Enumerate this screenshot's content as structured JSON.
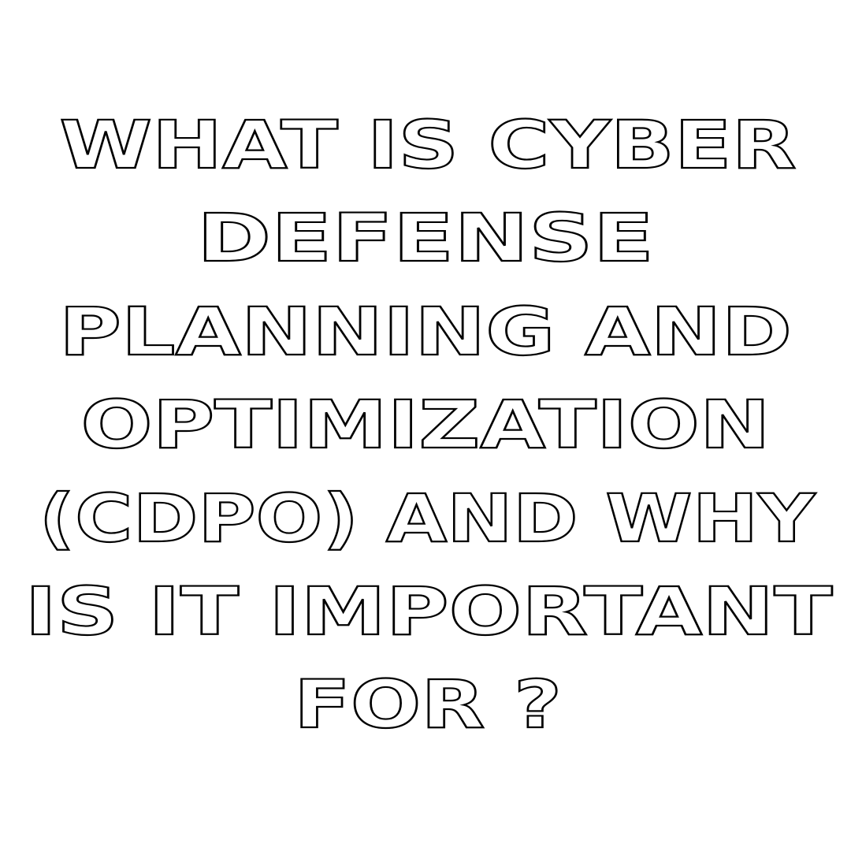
{
  "headline": {
    "lines": [
      "WHAT IS CYBER",
      "DEFENSE",
      "PLANNING AND",
      "OPTIMIZATION",
      "(CDPO) AND WHY",
      "IS IT IMPORTANT",
      "FOR ?"
    ]
  },
  "colors": {
    "background": "#ffffff",
    "outline": "#000000"
  }
}
